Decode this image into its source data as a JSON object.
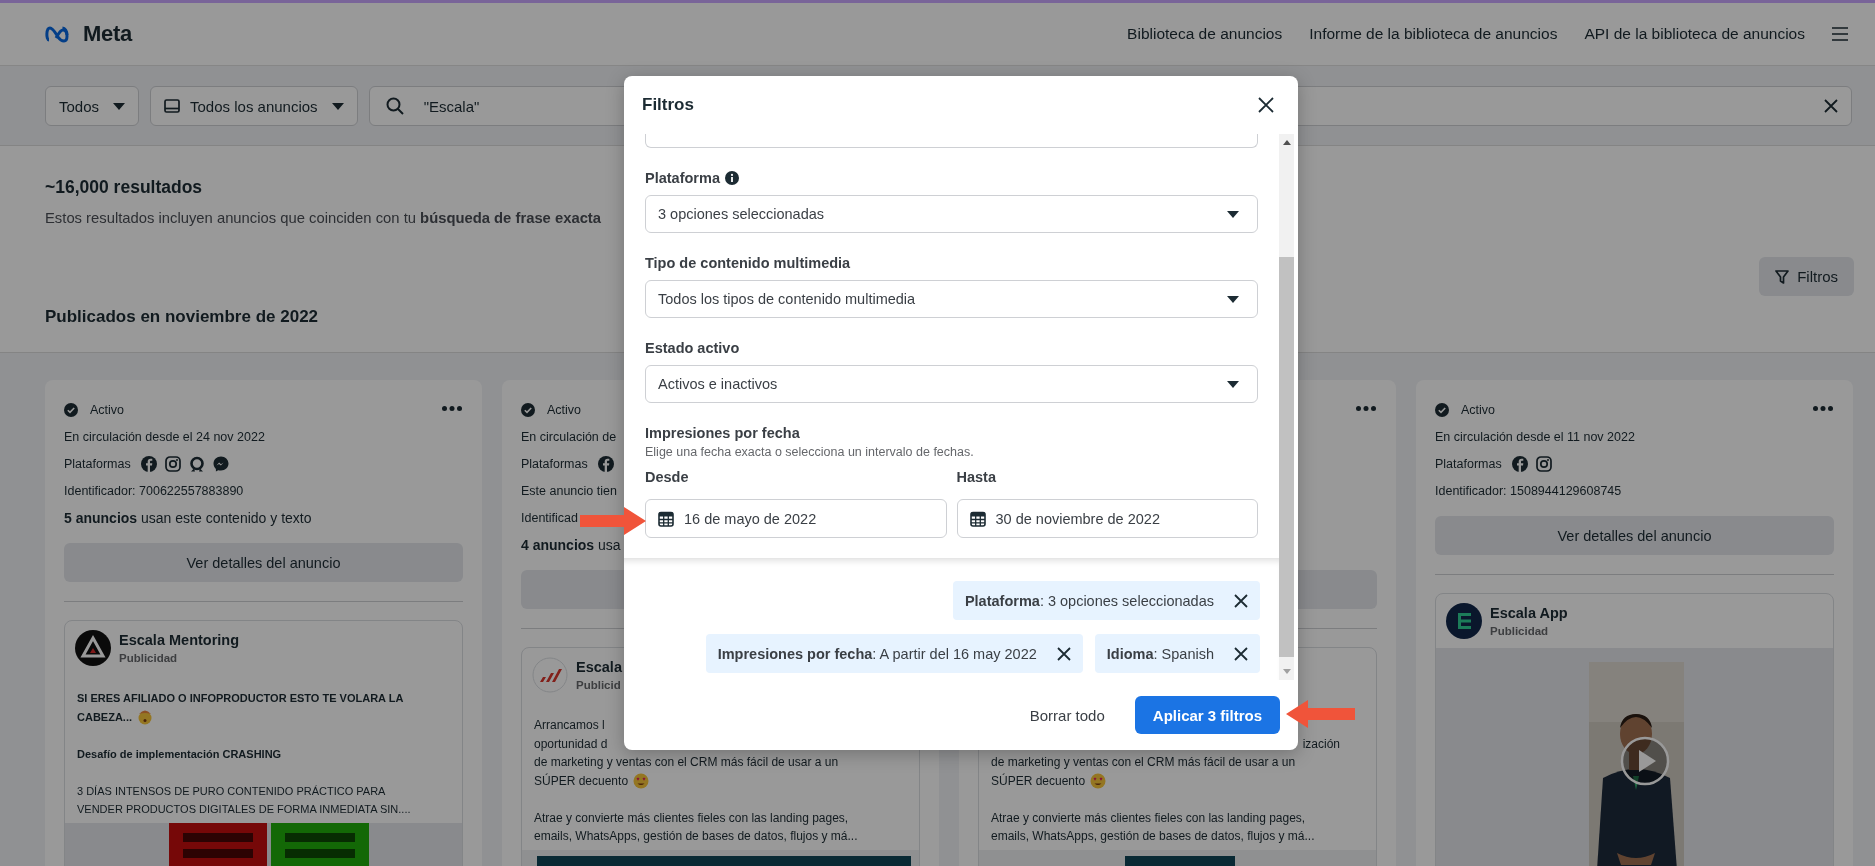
{
  "nav": {
    "logo": "Meta",
    "links": [
      "Biblioteca de anuncios",
      "Informe de la biblioteca de anuncios",
      "API de la biblioteca de anuncios"
    ]
  },
  "search_bar": {
    "country": "Todos",
    "ad_category": "Todos los anuncios",
    "query": "\"Escala\""
  },
  "results": {
    "count": "~16,000 resultados",
    "note": "Estos resultados incluyen anuncios que coinciden con tu **búsqueda de frase exacta**",
    "filters_button": "Filtros",
    "section_title": "Publicados en noviembre de 2022"
  },
  "cards": [
    {
      "kind": "full",
      "status": "Activo",
      "menu": true,
      "since": "En circulación desde el 24 nov 2022",
      "platforms_label": "Plataformas",
      "platforms": [
        {
          "kind": "facebook"
        },
        {
          "kind": "instagram"
        },
        {
          "kind": "audience"
        },
        {
          "kind": "messenger"
        }
      ],
      "identifier": "Identificador: 700622557883890",
      "count": "**5 anuncios** usan este contenido y texto",
      "details_button": true,
      "details_label": "Ver detalles del anuncio",
      "ad": {
        "logo": {
          "kind": "triangle"
        },
        "name": "Escala Mentoring",
        "sub": "Publicidad",
        "paragraphs": [
          {
            "lines": [
              {
                "text": "SI ERES AFILIADO O INFOPRODUCTOR ESTO TE VOLARA LA"
              },
              {
                "text": "CABEZA...",
                "emoji": {
                  "kind": "exploding"
                }
              }
            ]
          },
          {
            "lines": [
              {
                "text": "Desafío de implementación CRASHING"
              }
            ]
          },
          {
            "lines": [
              {
                "text": "3 DÍAS INTENSOS DE PURO CONTENIDO PRÁCTICO PARA"
              },
              {
                "text": "VENDER PRODUCTOS DIGITALES DE FORMA INMEDIATA SIN...."
              }
            ]
          }
        ]
      }
    },
    {
      "kind": "full",
      "status": "Activo",
      "since": "En circulación de",
      "platforms_label": "Plataformas",
      "platforms": [
        {
          "kind": "facebook"
        }
      ],
      "note": "Este anuncio tien",
      "identifier": "Identificad",
      "count": "**4 anuncios** usa",
      "details_button": true,
      "ad": {
        "logo": {
          "kind": "stripes"
        },
        "name": "Escala",
        "sub": "Publicid",
        "paragraphs": [
          {
            "lines": [
              {
                "text": "Arrancamos l"
              },
              {
                "text": "oportunidad d"
              },
              {
                "text": "de marketing y ventas con el CRM más fácil de usar a un"
              },
              {
                "text": "SÚPER decuento",
                "emoji": {
                  "kind": "heart_eyes"
                }
              }
            ]
          },
          {
            "lines": [
              {
                "text": "Atrae y convierte más clientes fieles con las landing pages,"
              },
              {
                "text": "emails, WhatsApps, gestión de bases de datos, flujos y má..."
              }
            ]
          }
        ]
      }
    },
    {
      "kind": "covered",
      "menu": true,
      "details_button": true,
      "ad": {
        "paragraphs": [
          {
            "lines": [
              {
                "kind": "tail",
                "text": "ización"
              },
              {
                "text": "de marketing y ventas con el CRM más fácil de usar a un"
              },
              {
                "text": "SÚPER decuento",
                "emoji": {
                  "kind": "heart_eyes"
                }
              }
            ]
          },
          {
            "lines": [
              {
                "text": "Atrae y convierte más clientes fieles con las landing pages,"
              },
              {
                "text": "emails, WhatsApps, gestión de bases de datos, flujos y má..."
              }
            ]
          }
        ]
      }
    },
    {
      "kind": "full",
      "status": "Activo",
      "menu": true,
      "since": "En circulación desde el 11 nov 2022",
      "platforms_label": "Plataformas",
      "platforms": [
        {
          "kind": "facebook"
        },
        {
          "kind": "instagram"
        }
      ],
      "identifier": "Identificador: 1508944129608745",
      "details_button": true,
      "details_label": "Ver detalles del anuncio",
      "ad": {
        "logo": {
          "kind": "bars"
        },
        "name": "Escala App",
        "sub": "Publicidad",
        "media": {
          "kind": "video"
        }
      }
    }
  ],
  "modal": {
    "title": "Filtros",
    "fields": [
      {
        "kind": "partial"
      },
      {
        "kind": "select",
        "label": "Plataforma",
        "info": true,
        "value": "3 opciones seleccionadas"
      },
      {
        "kind": "select",
        "label": "Tipo de contenido multimedia",
        "value": "Todos los tipos de contenido multimedia"
      },
      {
        "kind": "select",
        "label": "Estado activo",
        "value": "Activos e inactivos"
      },
      {
        "kind": "date_range",
        "label": "Impresiones por fecha",
        "hint": "Elige una fecha exacta o selecciona un intervalo de fechas.",
        "from_label": "Desde",
        "from": "16 de mayo de 2022",
        "to_label": "Hasta",
        "to": "30 de noviembre de 2022"
      }
    ],
    "chips": [
      "**Plataforma**: 3 opciones seleccionadas",
      "**Impresiones por fecha**: A partir del 16 may 2022",
      "**Idioma**: Spanish"
    ],
    "clear_button": "Borrar todo",
    "apply_button": "Aplicar 3 filtros"
  },
  "annotations": [
    {
      "kind": "arrow_right"
    },
    {
      "kind": "arrow_left"
    }
  ]
}
